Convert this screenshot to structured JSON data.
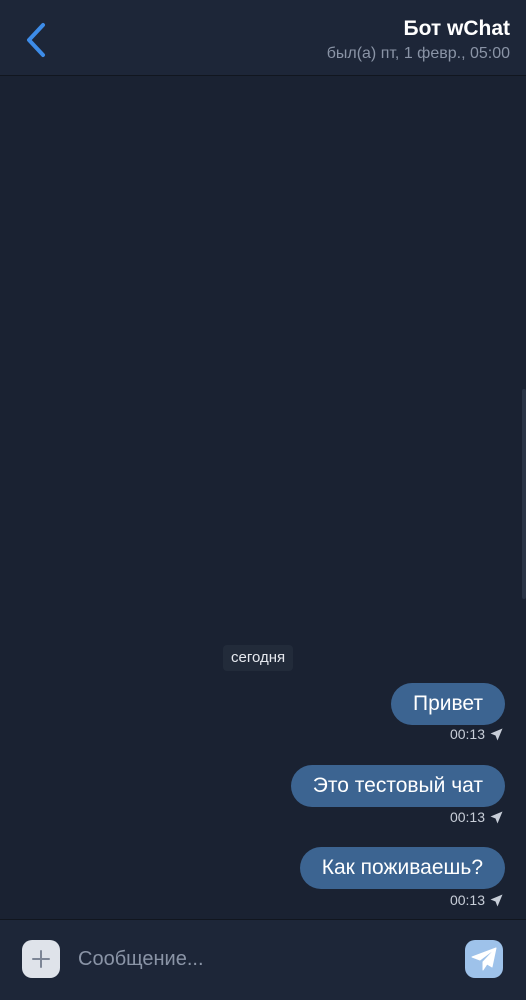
{
  "header": {
    "title": "Бот wChat",
    "status": "был(а) пт, 1 февр., 05:00",
    "back_icon": "chevron-left-icon"
  },
  "messages": {
    "date_separator": "сегодня",
    "items": [
      {
        "text": "Привет",
        "time": "00:13",
        "status_icon": "sent-arrow-icon"
      },
      {
        "text": "Это тестовый чат",
        "time": "00:13",
        "status_icon": "sent-arrow-icon"
      },
      {
        "text": "Как поживаешь?",
        "time": "00:13",
        "status_icon": "sent-arrow-icon"
      }
    ]
  },
  "composer": {
    "placeholder": "Сообщение...",
    "value": "",
    "attach_icon": "plus-icon",
    "send_icon": "paper-plane-icon"
  },
  "colors": {
    "background": "#1a2232",
    "header": "#1d2638",
    "bubble": "#3c6491",
    "accent": "#3d8ce8",
    "send_button": "#9ec2ea"
  }
}
